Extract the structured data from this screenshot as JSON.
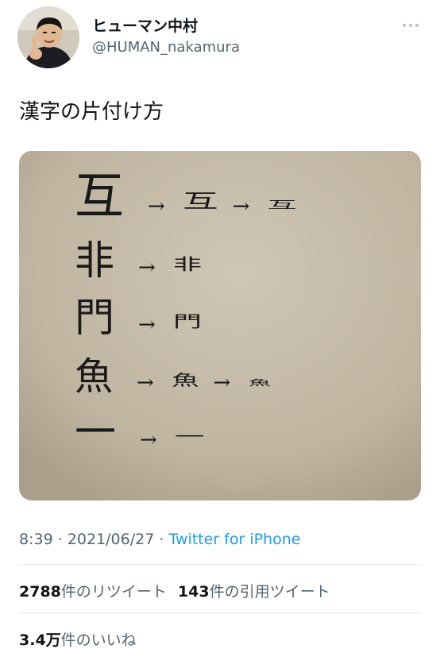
{
  "user": {
    "display_name": "ヒューマン中村",
    "handle": "@HUMAN_nakamura"
  },
  "icons": {
    "more": "more-horizontal-icon",
    "avatar": "profile-photo"
  },
  "tweet": {
    "text": "漢字の片付け方",
    "image_description_icon": "handwritten-kanji-photo",
    "image": {
      "rows": [
        [
          "互",
          "→",
          "互",
          "→",
          "互"
        ],
        [
          "非",
          "→",
          "非"
        ],
        [
          "門",
          "→",
          "門"
        ],
        [
          "魚",
          "→",
          "魚",
          "→",
          "魚"
        ],
        [
          "一",
          "→",
          "一"
        ]
      ]
    }
  },
  "meta": {
    "time": "8:39",
    "sep1": " · ",
    "date": "2021/06/27",
    "sep2": " · ",
    "source": "Twitter for iPhone"
  },
  "stats": {
    "retweets_count": "2788",
    "retweets_label": "件のリツイート",
    "quotes_count": "143",
    "quotes_label": "件の引用ツイート",
    "likes_count": "3.4万",
    "likes_label": "件のいいね"
  },
  "colors": {
    "text": "#0f1419",
    "muted": "#536471",
    "link": "#1d9bf0",
    "divider": "#e6e9ec",
    "paper": "#c3b9a6",
    "ink": "#1a1a1a"
  }
}
